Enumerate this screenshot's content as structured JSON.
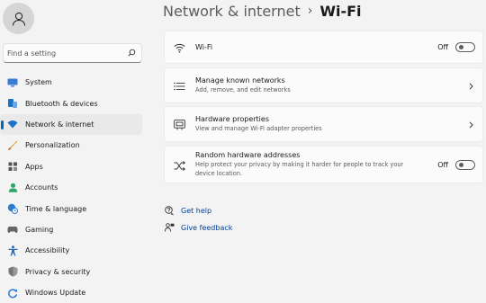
{
  "sidebar": {
    "search_placeholder": "Find a setting",
    "items": [
      {
        "label": "System",
        "icon": "monitor-icon",
        "color": "#3a7bd5"
      },
      {
        "label": "Bluetooth & devices",
        "icon": "bluetooth-icon",
        "color": "#1a73c8"
      },
      {
        "label": "Network & internet",
        "icon": "wifi-icon",
        "color": "#1a73c8",
        "active": true
      },
      {
        "label": "Personalization",
        "icon": "brush-icon",
        "color": "#e39b2c"
      },
      {
        "label": "Apps",
        "icon": "apps-icon",
        "color": "#555555"
      },
      {
        "label": "Accounts",
        "icon": "person-icon",
        "color": "#2ea46b"
      },
      {
        "label": "Time & language",
        "icon": "clock-globe-icon",
        "color": "#2b7cd3"
      },
      {
        "label": "Gaming",
        "icon": "gamepad-icon",
        "color": "#666666"
      },
      {
        "label": "Accessibility",
        "icon": "accessibility-icon",
        "color": "#2b6fb8"
      },
      {
        "label": "Privacy & security",
        "icon": "shield-icon",
        "color": "#777777"
      },
      {
        "label": "Windows Update",
        "icon": "update-icon",
        "color": "#2b7cd3"
      }
    ]
  },
  "header": {
    "parent": "Network & internet",
    "separator": "›",
    "current": "Wi-Fi"
  },
  "cards": {
    "wifi": {
      "title": "Wi-Fi",
      "state": "Off"
    },
    "known": {
      "title": "Manage known networks",
      "subtitle": "Add, remove, and edit networks"
    },
    "hardware": {
      "title": "Hardware properties",
      "subtitle": "View and manage Wi-Fi adapter properties"
    },
    "random": {
      "title": "Random hardware addresses",
      "subtitle": "Help protect your privacy by making it harder for people to track your device location.",
      "state": "Off"
    }
  },
  "links": {
    "help": "Get help",
    "feedback": "Give feedback"
  },
  "colors": {
    "accent": "#0067c0",
    "link": "#003e92"
  }
}
